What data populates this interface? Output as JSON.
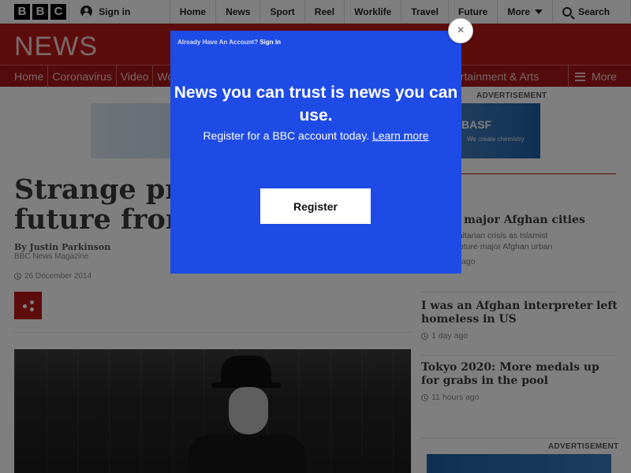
{
  "topbar": {
    "logo_letters": [
      "B",
      "B",
      "C"
    ],
    "signin_label": "Sign in",
    "nav": [
      "Home",
      "News",
      "Sport",
      "Reel",
      "Worklife",
      "Travel",
      "Future"
    ],
    "more_label": "More",
    "search_label": "Search"
  },
  "header": {
    "news_logo": "NEWS"
  },
  "subnav": {
    "items": [
      "Home",
      "Coronavirus",
      "Video",
      "Wo"
    ],
    "entertainment": "ertainment & Arts",
    "more_label": "More"
  },
  "ad": {
    "label": "ADVERTISEMENT",
    "brand": "BASF",
    "tagline": "We create chemistry"
  },
  "article": {
    "headline_line1": "Strange pre",
    "headline_line2": "future from",
    "author": "By Justin Parkinson",
    "role": "BBC News Magazine",
    "date": "26 December 2014"
  },
  "sidebar": {
    "heading": "ories",
    "stories": [
      {
        "title": "attack major Afghan cities",
        "summary_line1": "of a humanitarian crisis as Islamist",
        "summary_line2": "seek to capture major Afghan urban",
        "age": "6 hours ago"
      },
      {
        "title": "I was an Afghan interpreter left homeless in US",
        "age": "1 day ago"
      },
      {
        "title": "Tokyo 2020: More medals up for grabs in the pool",
        "age": "11 hours ago"
      }
    ],
    "ad_label": "ADVERTISEMENT"
  },
  "modal": {
    "already_text": "Already Have An Account?",
    "signin_link": "Sign In",
    "title": "News you can trust is news you can use.",
    "body_text": "Register for a BBC account today.",
    "learn_more": "Learn more",
    "register_label": "Register",
    "close_symbol": "×"
  },
  "colors": {
    "bbc_red": "#bb1919",
    "modal_blue": "#1e4be6"
  }
}
